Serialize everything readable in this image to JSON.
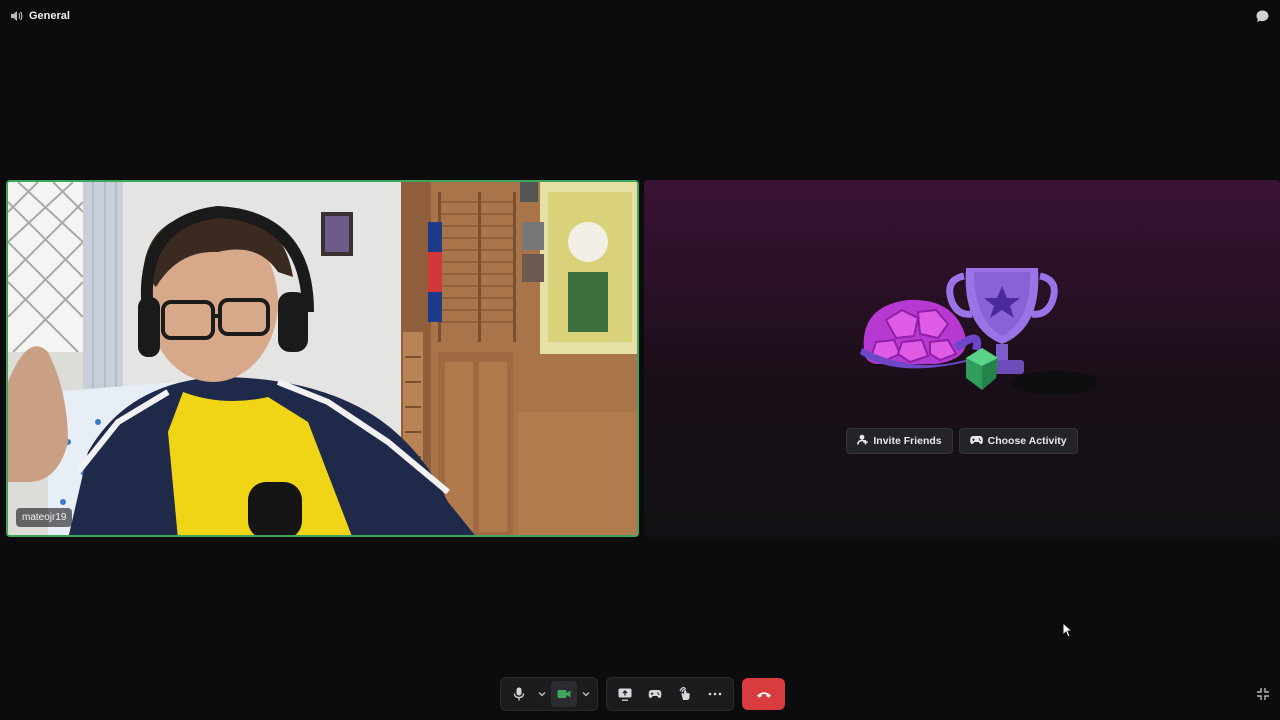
{
  "header": {
    "channel_icon": "speaker-icon",
    "channel_name": "General",
    "chat_icon": "chat-bubble-icon"
  },
  "participants": [
    {
      "username": "mateojr19",
      "speaking": true,
      "video": true
    }
  ],
  "activity_panel": {
    "invite_label": "Invite Friends",
    "invite_icon": "invite-user-icon",
    "activity_label": "Choose Activity",
    "activity_icon": "gamepad-icon"
  },
  "controls": {
    "mic_icon": "microphone-icon",
    "camera_icon": "camera-icon",
    "screen_share_icon": "screen-share-icon",
    "activities_icon": "gamepad-icon",
    "soundboard_icon": "soundboard-icon",
    "more_icon": "more-icon",
    "disconnect_icon": "hangup-icon",
    "fullscreen_icon": "exit-fullscreen-icon"
  },
  "colors": {
    "speaking_border": "#3fa55b",
    "disconnect": "#d83c3e",
    "camera_on": "#3fa55b"
  }
}
